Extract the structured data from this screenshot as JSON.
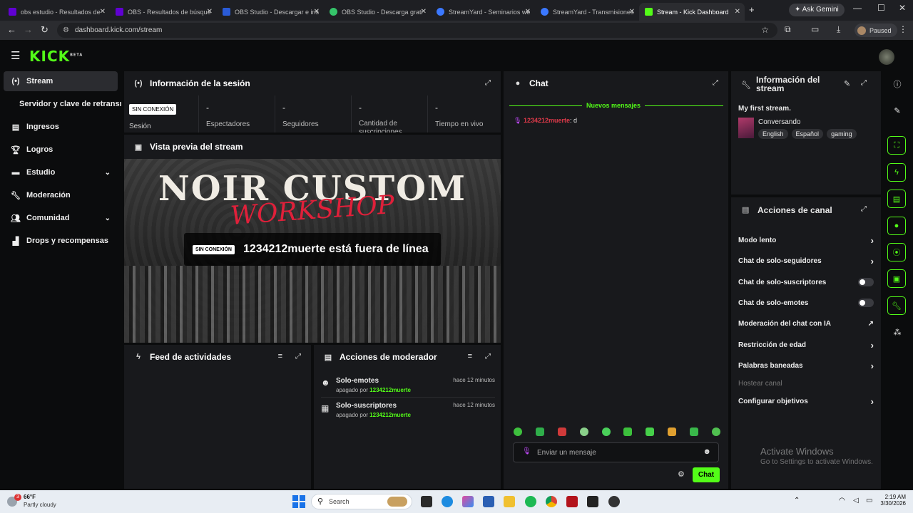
{
  "browser": {
    "tabs": [
      {
        "title": "obs estudio - Resultados de",
        "color": "#6001d2"
      },
      {
        "title": "OBS - Resultados de búsque",
        "color": "#6001d2"
      },
      {
        "title": "OBS Studio - Descargar e ins",
        "color": "#2a5bd7"
      },
      {
        "title": "OBS Studio - Descarga grati",
        "color": "#35c46a"
      },
      {
        "title": "StreamYard - Seminarios we",
        "color": "#3b78ff"
      },
      {
        "title": "StreamYard - Transmisiones",
        "color": "#3b78ff"
      },
      {
        "title": "Stream - Kick Dashboard",
        "color": "#53fc18",
        "active": true
      }
    ],
    "ask_gemini": "Ask Gemini",
    "url": "dashboard.kick.com/stream",
    "paused": "Paused"
  },
  "brand": {
    "logo": "KICK",
    "beta": "BETA"
  },
  "sidebar": {
    "items": [
      {
        "label": "Stream",
        "icon": "broadcast-icon"
      },
      {
        "label": "Servidor y clave de retransm",
        "icon": ""
      },
      {
        "label": "Ingresos",
        "icon": "chart-icon"
      },
      {
        "label": "Logros",
        "icon": "trophy-icon"
      },
      {
        "label": "Estudio",
        "icon": "studio-icon"
      },
      {
        "label": "Moderación",
        "icon": "wrench-icon"
      },
      {
        "label": "Comunidad",
        "icon": "people-icon"
      },
      {
        "label": "Drops y recompensas",
        "icon": "gift-icon"
      }
    ]
  },
  "session": {
    "title": "Información de la sesión",
    "status_badge": "SIN CONEXIÓN",
    "session_label": "Sesión",
    "stats": [
      {
        "value": "-",
        "label": "Espectadores"
      },
      {
        "value": "-",
        "label": "Seguidores"
      },
      {
        "value": "-",
        "label": "Cantidad de suscripciones"
      },
      {
        "value": "-",
        "label": "Tiempo en vivo"
      }
    ]
  },
  "preview": {
    "title": "Vista previa del stream",
    "banner_top": "NOIR CUSTOM",
    "banner_sub": "WORKSHOP",
    "offline_badge": "SIN CONEXIÓN",
    "offline_text": "1234212muerte está fuera de línea"
  },
  "feed": {
    "title": "Feed de actividades"
  },
  "modactions": {
    "title": "Acciones de moderador",
    "items": [
      {
        "name": "Solo-emotes",
        "by": "apagado por",
        "user": "1234212muerte",
        "time": "hace 12 minutos"
      },
      {
        "name": "Solo-suscriptores",
        "by": "apagado por",
        "user": "1234212muerte",
        "time": "hace 12 minutos"
      }
    ]
  },
  "chat": {
    "title": "Chat",
    "new_messages": "Nuevos mensajes",
    "messages": [
      {
        "user": "1234212muerte",
        "text": ": d"
      }
    ],
    "input_placeholder": "Enviar un mensaje",
    "send": "Chat"
  },
  "stream_info": {
    "title": "Información del stream",
    "stream_title": "My first stream.",
    "category": "Conversando",
    "tags": [
      "English",
      "Español",
      "gaming"
    ]
  },
  "channel_actions": {
    "title": "Acciones de canal",
    "items": [
      {
        "label": "Modo lento",
        "control": "arrow"
      },
      {
        "label": "Chat de solo-seguidores",
        "control": "arrow"
      },
      {
        "label": "Chat de solo-suscriptores",
        "control": "toggle"
      },
      {
        "label": "Chat de solo-emotes",
        "control": "toggle"
      },
      {
        "label": "Moderación del chat con IA",
        "control": "external"
      },
      {
        "label": "Restricción de edad",
        "control": "arrow"
      },
      {
        "label": "Palabras baneadas",
        "control": "arrow"
      },
      {
        "label": "Hostear canal",
        "control": "none",
        "muted": true
      },
      {
        "label": "Configurar objetivos",
        "control": "arrow"
      }
    ]
  },
  "watermark": {
    "line1": "Activate Windows",
    "line2": "Go to Settings to activate Windows."
  },
  "taskbar": {
    "weather_temp": "66°F",
    "weather_desc": "Partly cloudy",
    "search": "Search",
    "time": "2:19 AM",
    "date": "3/30/2026",
    "notif_count": "3"
  }
}
